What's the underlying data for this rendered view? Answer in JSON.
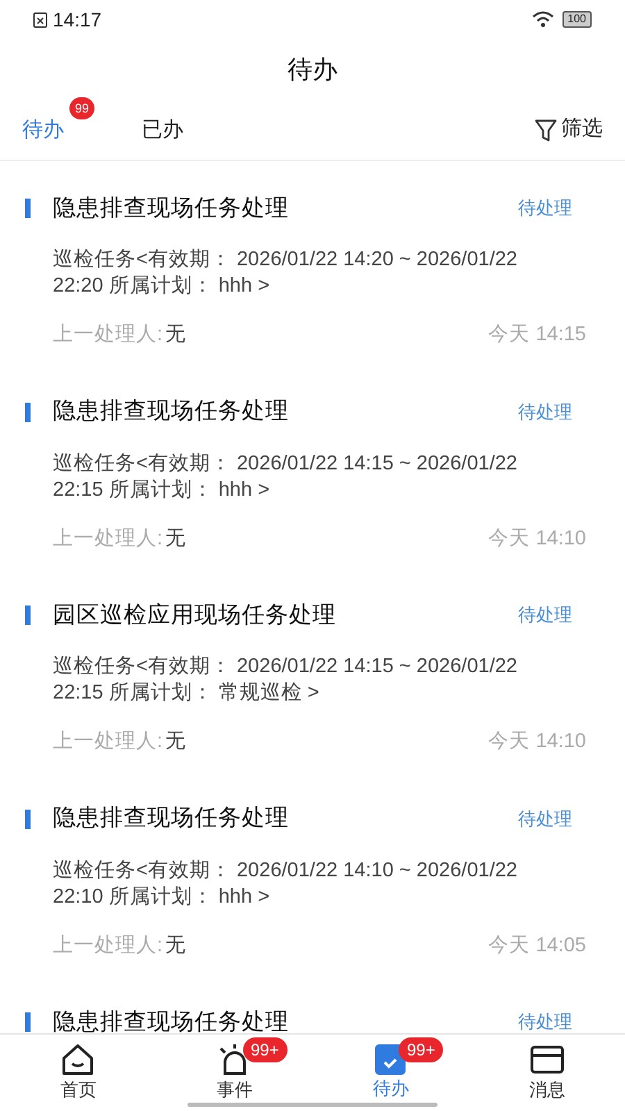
{
  "status_bar": {
    "time": "14:17",
    "battery": "100"
  },
  "header": {
    "title": "待办"
  },
  "tabs": [
    {
      "label": "待办",
      "selected": true,
      "badge": "99"
    },
    {
      "label": "已办",
      "selected": false
    }
  ],
  "filter": {
    "label": "筛选"
  },
  "tasks": [
    {
      "title": "隐患排查现场任务处理",
      "status": "待处理",
      "info": "巡检任务<有效期： 2026/01/22 14:20 ~ 2026/01/22 22:20 所属计划： hhh >",
      "prev_label": "上一处理人:",
      "prev_value": "无",
      "time": "今天 14:15"
    },
    {
      "title": "隐患排查现场任务处理",
      "status": "待处理",
      "info": "巡检任务<有效期： 2026/01/22 14:15 ~ 2026/01/22 22:15 所属计划： hhh >",
      "prev_label": "上一处理人:",
      "prev_value": "无",
      "time": "今天 14:10"
    },
    {
      "title": "园区巡检应用现场任务处理",
      "status": "待处理",
      "info": "巡检任务<有效期： 2026/01/22 14:15 ~ 2026/01/22 22:15 所属计划： 常规巡检 >",
      "prev_label": "上一处理人:",
      "prev_value": "无",
      "time": "今天 14:10"
    },
    {
      "title": "隐患排查现场任务处理",
      "status": "待处理",
      "info": "巡检任务<有效期： 2026/01/22 14:10 ~ 2026/01/22 22:10 所属计划： hhh >",
      "prev_label": "上一处理人:",
      "prev_value": "无",
      "time": "今天 14:05"
    },
    {
      "title": "隐患排查现场任务处理",
      "status": "待处理"
    }
  ],
  "nav": [
    {
      "kind": "home",
      "label": "首页",
      "selected": false
    },
    {
      "kind": "event",
      "label": "事件",
      "selected": false,
      "badge": "99+"
    },
    {
      "kind": "todo",
      "label": "待办",
      "selected": true,
      "badge": "99+"
    },
    {
      "kind": "message",
      "label": "消息",
      "selected": false
    }
  ]
}
